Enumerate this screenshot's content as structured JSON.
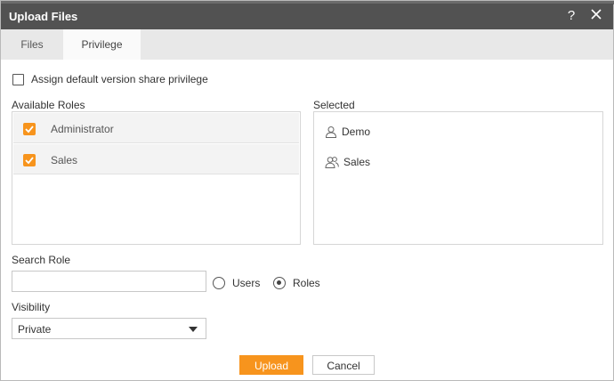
{
  "dialog": {
    "title": "Upload Files",
    "help_label": "?",
    "close_label": "✕"
  },
  "tabs": [
    {
      "label": "Files",
      "active": false
    },
    {
      "label": "Privilege",
      "active": true
    }
  ],
  "assign_default": {
    "label": "Assign default version share privilege",
    "checked": false
  },
  "available_roles": {
    "label": "Available Roles",
    "items": [
      {
        "label": "Administrator",
        "checked": true
      },
      {
        "label": "Sales",
        "checked": true
      }
    ]
  },
  "selected": {
    "label": "Selected",
    "items": [
      {
        "label": "Demo",
        "icon": "user-icon"
      },
      {
        "label": "Sales",
        "icon": "group-icon"
      }
    ]
  },
  "search_role": {
    "label": "Search Role",
    "value": "",
    "placeholder": "",
    "options": [
      {
        "label": "Users",
        "selected": false
      },
      {
        "label": "Roles",
        "selected": true
      }
    ]
  },
  "visibility": {
    "label": "Visibility",
    "value": "Private"
  },
  "buttons": {
    "upload": "Upload",
    "cancel": "Cancel"
  },
  "colors": {
    "accent": "#f7941d",
    "titlebar": "#525252"
  }
}
